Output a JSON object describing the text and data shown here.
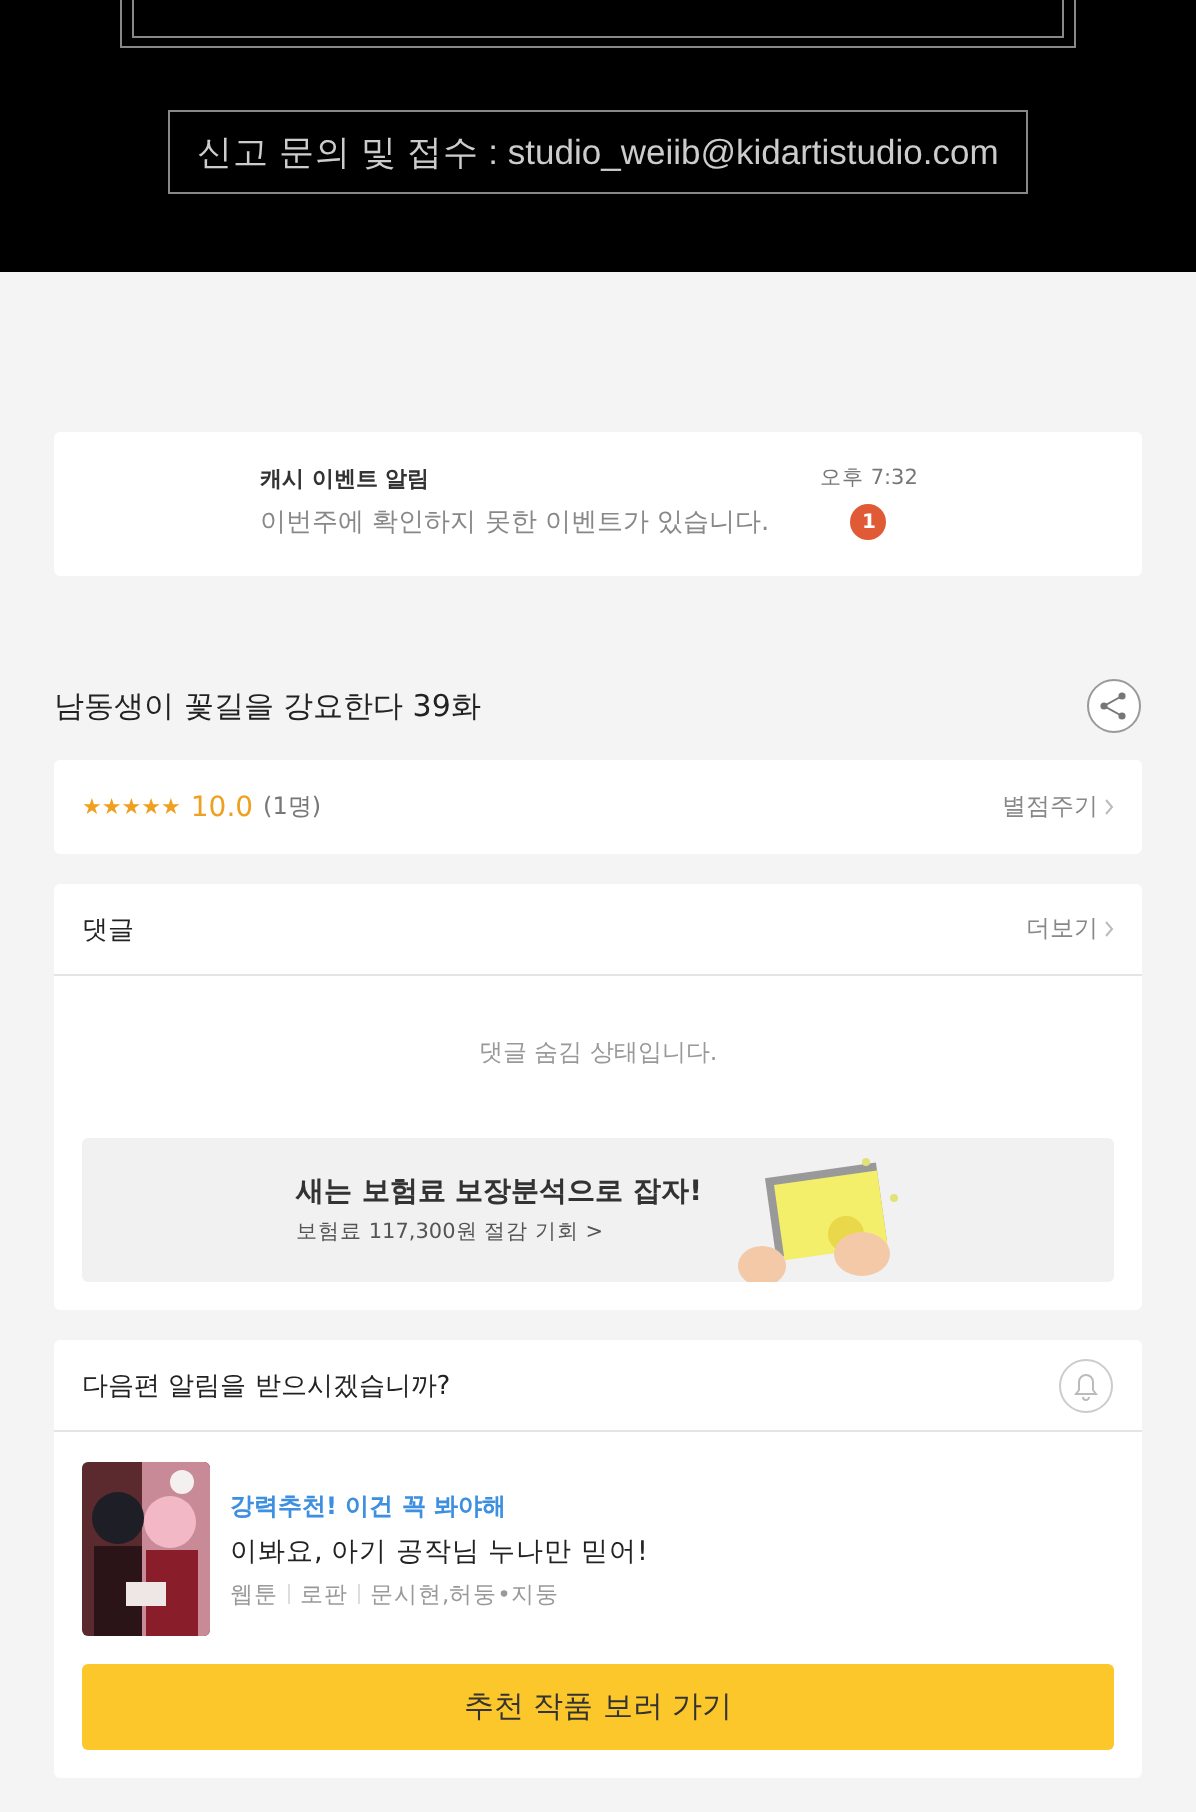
{
  "banner": {
    "contact": "신고 문의 및 접수 : studio_weiib@kidartistudio.com"
  },
  "notification": {
    "title": "캐시 이벤트 알림",
    "message": "이번주에 확인하지 못한 이벤트가 있습니다.",
    "time": "오후 7:32",
    "badge": "1"
  },
  "episode": {
    "title": "남동생이 꽃길을 강요한다 39화"
  },
  "rating": {
    "stars": 5,
    "score": "10.0",
    "count": "(1명)",
    "action": "별점주기"
  },
  "comments": {
    "title": "댓글",
    "more": "더보기",
    "notice": "댓글 숨김 상태입니다.",
    "ad": {
      "headline": "새는 보험료 보장분석으로 잡자!",
      "subline": "보험료 117,300원 절감 기회 >"
    }
  },
  "next_alert": {
    "question": "다음편 알림을 받으시겠습니까?",
    "on": false,
    "recommendation": {
      "tagline": "강력추천! 이건 꼭 봐야해",
      "title": "이봐요, 아기 공작님 누나만 믿어!",
      "meta": [
        "웹툰",
        "로판",
        "문시현,허둥•지둥"
      ]
    },
    "button": "추천 작품 보러 가기"
  }
}
